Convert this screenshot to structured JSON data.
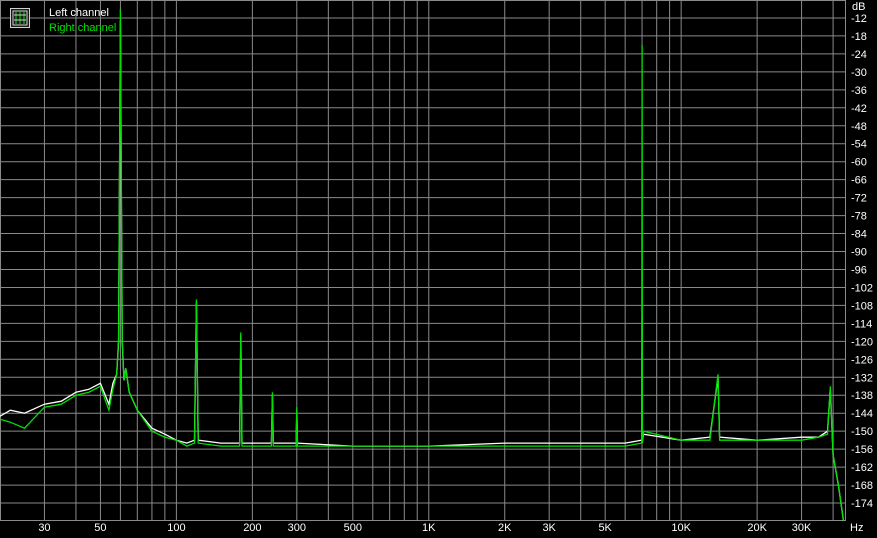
{
  "chart_data": {
    "type": "line",
    "xscale": "log",
    "xlim": [
      20,
      45000
    ],
    "ylim": [
      -180,
      -6
    ],
    "y_unit": "dB",
    "x_unit": "Hz",
    "grid": true,
    "legend_position": "top-left",
    "x_ticks": [
      {
        "value": 30,
        "label": "30"
      },
      {
        "value": 50,
        "label": "50"
      },
      {
        "value": 100,
        "label": "100"
      },
      {
        "value": 200,
        "label": "200"
      },
      {
        "value": 300,
        "label": "300"
      },
      {
        "value": 500,
        "label": "500"
      },
      {
        "value": 1000,
        "label": "1K"
      },
      {
        "value": 2000,
        "label": "2K"
      },
      {
        "value": 3000,
        "label": "3K"
      },
      {
        "value": 5000,
        "label": "5K"
      },
      {
        "value": 10000,
        "label": "10K"
      },
      {
        "value": 20000,
        "label": "20K"
      },
      {
        "value": 30000,
        "label": "30K"
      }
    ],
    "x_grid": [
      20,
      30,
      40,
      50,
      60,
      70,
      80,
      90,
      100,
      200,
      300,
      400,
      500,
      600,
      700,
      800,
      900,
      1000,
      2000,
      3000,
      4000,
      5000,
      6000,
      7000,
      8000,
      9000,
      10000,
      20000,
      30000,
      40000
    ],
    "y_ticks": [
      -12,
      -18,
      -24,
      -30,
      -36,
      -42,
      -48,
      -54,
      -60,
      -66,
      -72,
      -78,
      -84,
      -90,
      -96,
      -102,
      -108,
      -114,
      -120,
      -126,
      -132,
      -138,
      -144,
      -150,
      -156,
      -162,
      -168,
      -174
    ],
    "series": [
      {
        "name": "Left channel",
        "color": "#ffffff",
        "points": [
          [
            20,
            -145
          ],
          [
            22,
            -143
          ],
          [
            25,
            -144
          ],
          [
            30,
            -141
          ],
          [
            35,
            -140
          ],
          [
            40,
            -137
          ],
          [
            45,
            -136
          ],
          [
            50,
            -134
          ],
          [
            54,
            -141
          ],
          [
            56,
            -134
          ],
          [
            58,
            -131
          ],
          [
            59,
            -120
          ],
          [
            60,
            -13
          ],
          [
            61,
            -120
          ],
          [
            62,
            -133
          ],
          [
            63,
            -129
          ],
          [
            65,
            -137
          ],
          [
            70,
            -143
          ],
          [
            80,
            -149
          ],
          [
            90,
            -151
          ],
          [
            100,
            -153
          ],
          [
            110,
            -154
          ],
          [
            118,
            -153
          ],
          [
            120,
            -107
          ],
          [
            122,
            -153
          ],
          [
            150,
            -154
          ],
          [
            178,
            -154
          ],
          [
            180,
            -118
          ],
          [
            182,
            -154
          ],
          [
            200,
            -154
          ],
          [
            238,
            -154
          ],
          [
            240,
            -138
          ],
          [
            242,
            -154
          ],
          [
            298,
            -154
          ],
          [
            300,
            -143
          ],
          [
            302,
            -154
          ],
          [
            500,
            -155
          ],
          [
            1000,
            -155
          ],
          [
            2000,
            -154
          ],
          [
            5000,
            -154
          ],
          [
            6000,
            -154
          ],
          [
            6980,
            -153
          ],
          [
            7000,
            -112
          ],
          [
            7020,
            -153
          ],
          [
            7100,
            -151
          ],
          [
            10000,
            -153
          ],
          [
            13000,
            -152
          ],
          [
            14000,
            -132
          ],
          [
            14200,
            -152
          ],
          [
            20000,
            -153
          ],
          [
            30000,
            -152
          ],
          [
            35000,
            -152
          ],
          [
            38000,
            -150
          ],
          [
            39000,
            -136
          ],
          [
            40000,
            -158
          ],
          [
            42000,
            -168
          ],
          [
            44000,
            -180
          ]
        ]
      },
      {
        "name": "Right channel",
        "color": "#00e000",
        "points": [
          [
            20,
            -146
          ],
          [
            22,
            -147
          ],
          [
            25,
            -149
          ],
          [
            30,
            -142
          ],
          [
            35,
            -141
          ],
          [
            40,
            -138
          ],
          [
            45,
            -137
          ],
          [
            50,
            -135
          ],
          [
            54,
            -143
          ],
          [
            56,
            -136
          ],
          [
            58,
            -131
          ],
          [
            59,
            -119
          ],
          [
            60,
            -9
          ],
          [
            61,
            -119
          ],
          [
            62,
            -133
          ],
          [
            63,
            -129
          ],
          [
            65,
            -137
          ],
          [
            70,
            -143
          ],
          [
            80,
            -150
          ],
          [
            90,
            -152
          ],
          [
            100,
            -153
          ],
          [
            110,
            -155
          ],
          [
            118,
            -154
          ],
          [
            120,
            -106
          ],
          [
            122,
            -154
          ],
          [
            150,
            -155
          ],
          [
            178,
            -155
          ],
          [
            180,
            -117
          ],
          [
            182,
            -155
          ],
          [
            200,
            -155
          ],
          [
            238,
            -155
          ],
          [
            240,
            -137
          ],
          [
            242,
            -155
          ],
          [
            298,
            -155
          ],
          [
            300,
            -142
          ],
          [
            302,
            -155
          ],
          [
            500,
            -155
          ],
          [
            1000,
            -155
          ],
          [
            2000,
            -155
          ],
          [
            5000,
            -155
          ],
          [
            6000,
            -155
          ],
          [
            6980,
            -154
          ],
          [
            7000,
            -21
          ],
          [
            7020,
            -154
          ],
          [
            7100,
            -150
          ],
          [
            10000,
            -153
          ],
          [
            13000,
            -153
          ],
          [
            14000,
            -131
          ],
          [
            14200,
            -153
          ],
          [
            20000,
            -153
          ],
          [
            30000,
            -153
          ],
          [
            35000,
            -152
          ],
          [
            38000,
            -151
          ],
          [
            39000,
            -135
          ],
          [
            40000,
            -158
          ],
          [
            42000,
            -168
          ],
          [
            44000,
            -180
          ]
        ]
      }
    ]
  },
  "labels": {
    "y_unit_label": "dB",
    "x_unit_label": "Hz"
  },
  "legend": {
    "left_label": "Left channel",
    "right_label": "Right channel"
  }
}
